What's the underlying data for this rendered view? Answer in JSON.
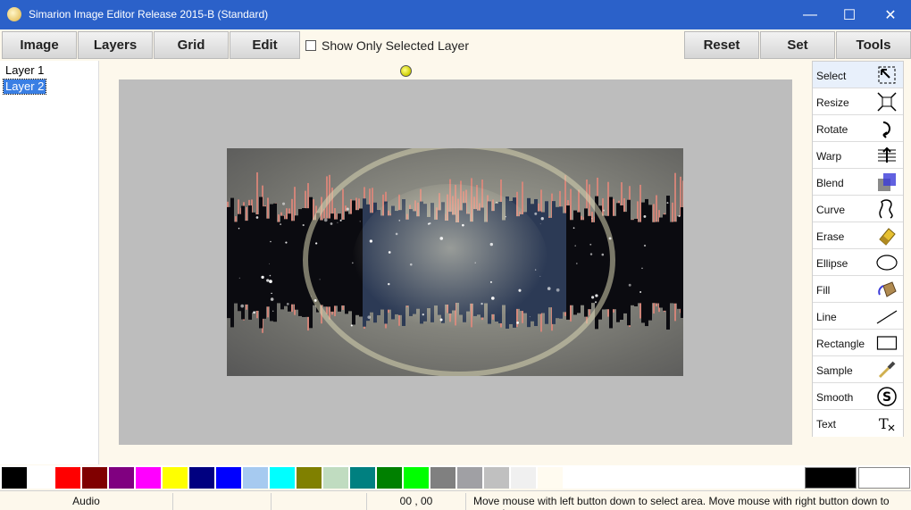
{
  "window": {
    "title": "Simarion Image Editor Release 2015-B (Standard)",
    "controls": {
      "minimize": "—",
      "maximize": "☐",
      "close": "✕"
    }
  },
  "menu": {
    "left": [
      "Image",
      "Layers",
      "Grid",
      "Edit"
    ],
    "checkbox_label": "Show Only Selected Layer",
    "checkbox_checked": false,
    "right": [
      "Reset",
      "Set",
      "Tools"
    ]
  },
  "layers": [
    "Layer 1",
    "Layer 2"
  ],
  "selected_layer": "Layer 2",
  "tools": [
    "Select",
    "Resize",
    "Rotate",
    "Warp",
    "Blend",
    "Curve",
    "Erase",
    "Ellipse",
    "Fill",
    "Line",
    "Rectangle",
    "Sample",
    "Smooth",
    "Text"
  ],
  "selected_tool": "Select",
  "tool_icons": [
    "select-icon",
    "resize-icon",
    "rotate-icon",
    "warp-icon",
    "blend-icon",
    "curve-icon",
    "eraser-icon",
    "ellipse-icon",
    "fill-bucket-icon",
    "line-icon",
    "rectangle-icon",
    "eyedropper-icon",
    "smooth-icon",
    "text-clear-icon"
  ],
  "palette": [
    "#000000",
    "#ffffff",
    "#ff0000",
    "#800000",
    "#800080",
    "#ff00ff",
    "#ffff00",
    "#000080",
    "#0000ff",
    "#a6caf0",
    "#00ffff",
    "#808000",
    "#c0dcc0",
    "#008080",
    "#008000",
    "#00ff00",
    "#808080",
    "#a0a0a4",
    "#c0c0c0",
    "#f0f0f0",
    "#fffbf0"
  ],
  "current_colors": {
    "primary": "#000000",
    "secondary": "#ffffff"
  },
  "status": {
    "audio": "Audio",
    "coords": "00 , 00",
    "hint": "Move mouse with left button down to select area. Move mouse with right button down to move image."
  }
}
